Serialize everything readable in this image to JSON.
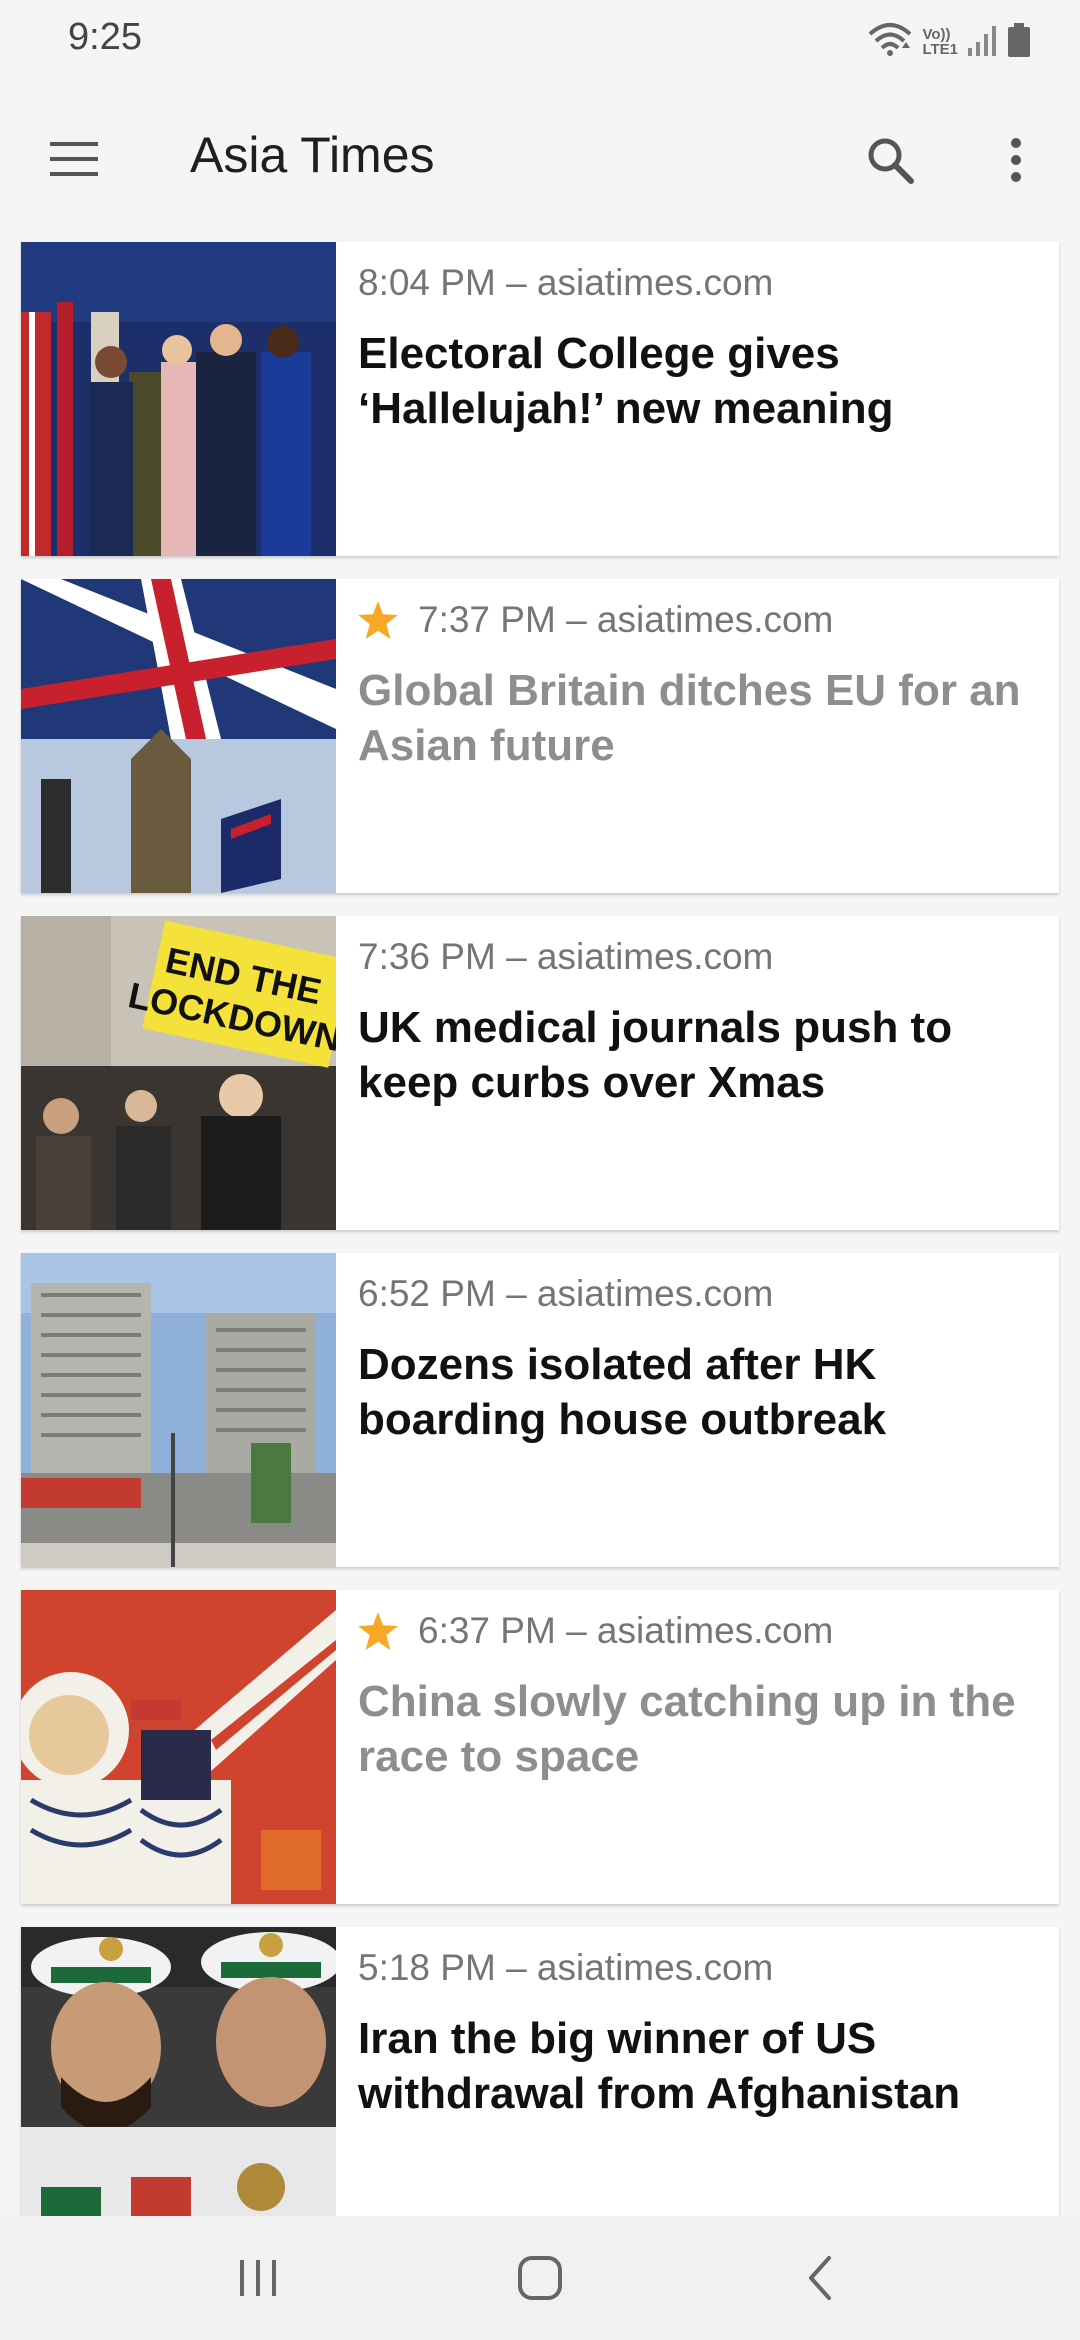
{
  "status_bar": {
    "time": "9:25",
    "icons": [
      "wifi-icon",
      "volte-lte-icon",
      "signal-icon",
      "battery-icon"
    ],
    "volte_top": "Vo))",
    "volte_bottom": "LTE1"
  },
  "app_bar": {
    "title": "Asia Times",
    "icons": [
      "menu-icon",
      "search-icon",
      "more-vert-icon"
    ]
  },
  "articles": [
    {
      "time": "8:04 PM",
      "source": "asiatimes.com",
      "meta": "8:04 PM – asiatimes.com",
      "title": "Electoral College gives ‘Hallelujah!’ new meaning",
      "starred": false,
      "read": false
    },
    {
      "time": "7:37 PM",
      "source": "asiatimes.com",
      "meta": "7:37 PM – asiatimes.com",
      "title": "Global Britain ditches EU for an Asian future",
      "starred": true,
      "read": true
    },
    {
      "time": "7:36 PM",
      "source": "asiatimes.com",
      "meta": "7:36 PM – asiatimes.com",
      "title": "UK medical journals push to keep curbs over Xmas",
      "starred": false,
      "read": false,
      "image_sign_text": "END THE LOCKDOWN"
    },
    {
      "time": "6:52 PM",
      "source": "asiatimes.com",
      "meta": "6:52 PM – asiatimes.com",
      "title": "Dozens isolated after HK boarding house outbreak",
      "starred": false,
      "read": false
    },
    {
      "time": "6:37 PM",
      "source": "asiatimes.com",
      "meta": "6:37 PM – asiatimes.com",
      "title": "China slowly catching up in the race to space",
      "starred": true,
      "read": true
    },
    {
      "time": "5:18 PM",
      "source": "asiatimes.com",
      "meta": "5:18 PM – asiatimes.com",
      "title": "Iran the big winner of US withdrawal from Afghanistan",
      "starred": false,
      "read": false
    }
  ],
  "nav_bar": {
    "icons": [
      "recents-icon",
      "home-icon",
      "back-icon"
    ]
  },
  "colors": {
    "background": "#f5f5f5",
    "card": "#ffffff",
    "headline": "#111111",
    "headline_read": "#8e8e8e",
    "meta": "#757575",
    "star": "#f9a825"
  }
}
